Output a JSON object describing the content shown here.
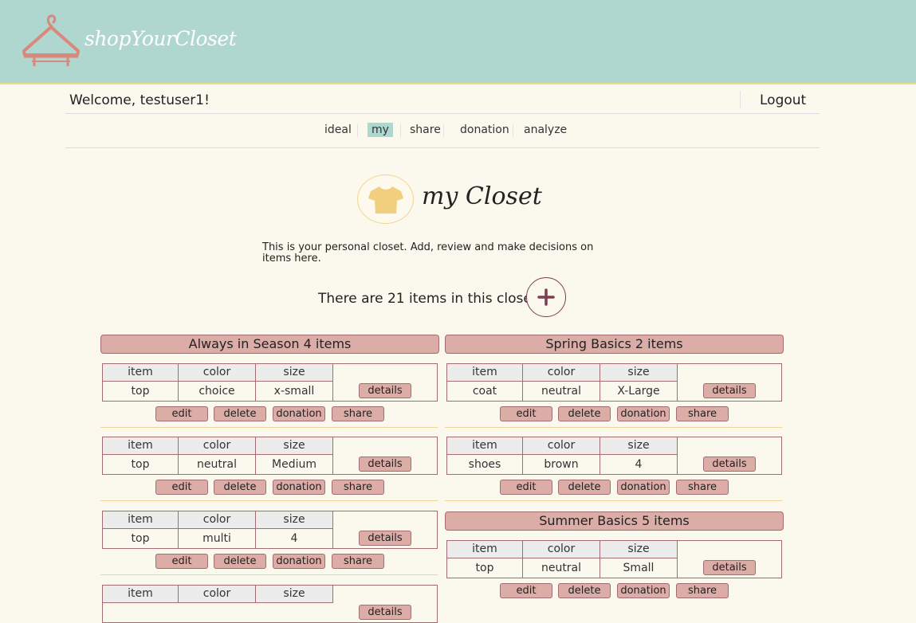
{
  "header": {
    "brand": "shopYourCloset"
  },
  "user": {
    "welcome": "Welcome, testuser1!",
    "logout": "Logout"
  },
  "nav": {
    "items": [
      {
        "label": "ideal",
        "active": false
      },
      {
        "label": "my",
        "active": true
      },
      {
        "label": "share",
        "active": false
      },
      {
        "label": "donation",
        "active": false
      },
      {
        "label": "analyze",
        "active": false
      }
    ]
  },
  "closet": {
    "title": "my Closet",
    "description": "This is your personal closet. Add, review and make decisions on items here.",
    "count_text": "There are 21 items in this closet."
  },
  "table_headers": {
    "item": "item",
    "color": "color",
    "size": "size"
  },
  "actions": {
    "details": "details",
    "edit": "edit",
    "delete": "delete",
    "donation": "donation",
    "share": "share"
  },
  "categories_left": [
    {
      "title": "Always in Season 4 items",
      "items": [
        {
          "item": "top",
          "color": "choice",
          "size": "x-small"
        },
        {
          "item": "top",
          "color": "neutral",
          "size": "Medium"
        },
        {
          "item": "top",
          "color": "multi",
          "size": "4"
        },
        {
          "item": "",
          "color": "",
          "size": ""
        }
      ]
    }
  ],
  "categories_right": [
    {
      "title": "Spring Basics 2 items",
      "items": [
        {
          "item": "coat",
          "color": "neutral",
          "size": "X-Large"
        },
        {
          "item": "shoes",
          "color": "brown",
          "size": "4"
        }
      ]
    },
    {
      "title": "Summer Basics 5 items",
      "items": [
        {
          "item": "top",
          "color": "neutral",
          "size": "Small"
        }
      ]
    }
  ],
  "colors": {
    "header_bg": "#afd6cf",
    "page_bg": "#fbf8ed",
    "accent_pink": "#dcaca6",
    "border_plum": "#a36b72",
    "logo_coral": "#d9887a"
  }
}
